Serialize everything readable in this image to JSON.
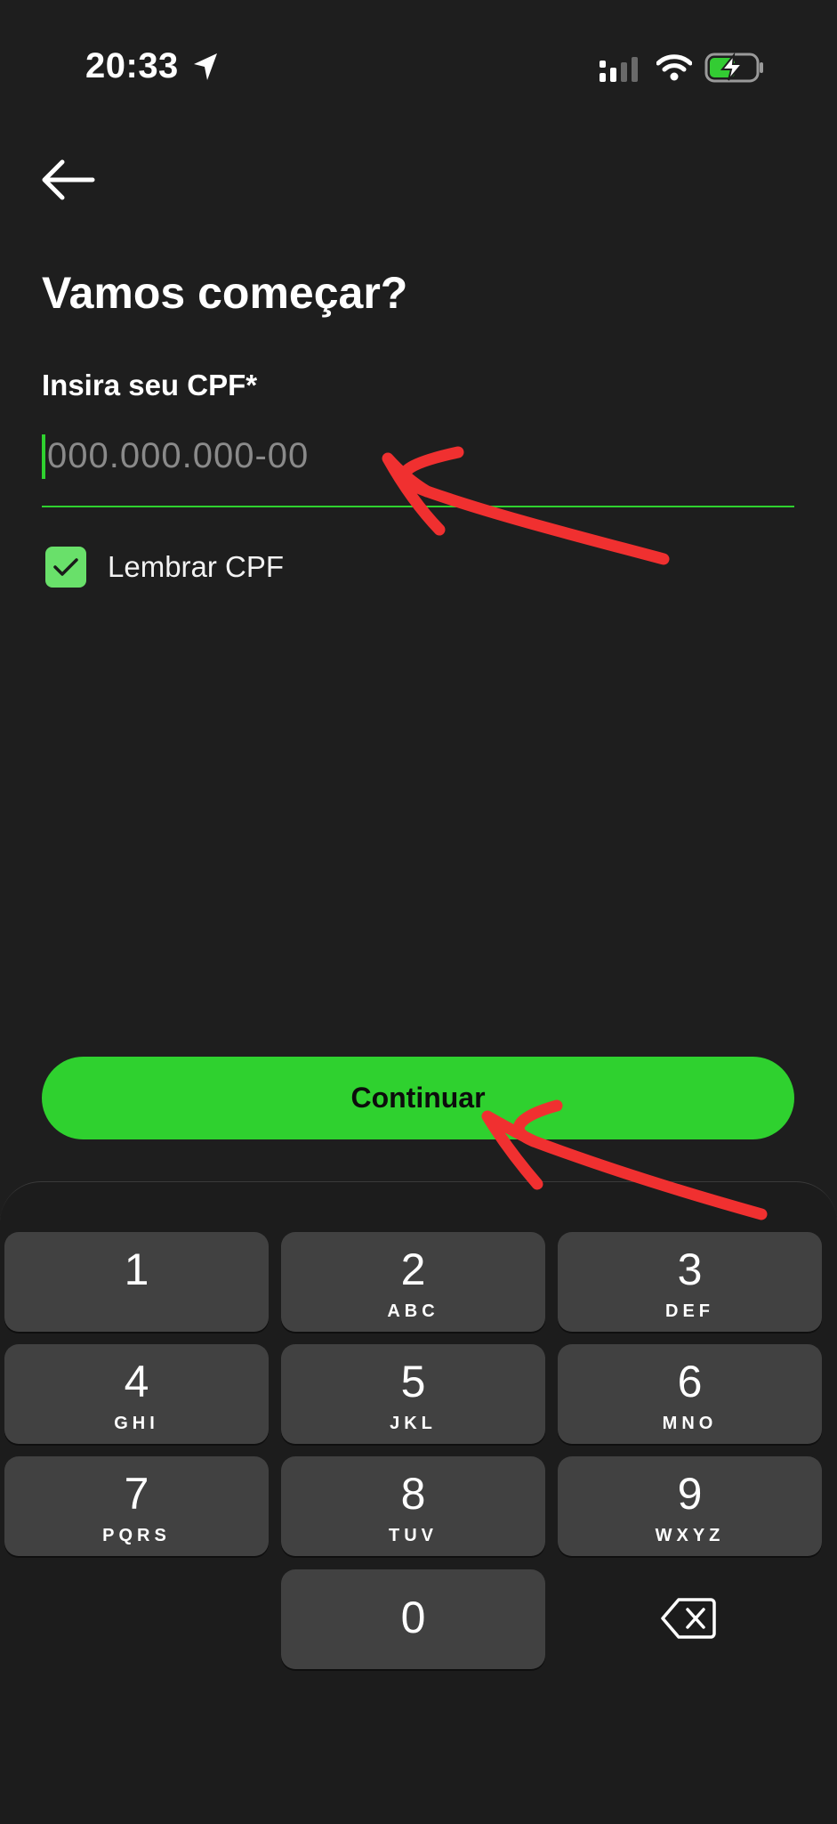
{
  "status_bar": {
    "time": "20:33"
  },
  "header": {
    "back_icon": "arrow-left-icon"
  },
  "main": {
    "title": "Vamos começar?",
    "cpf_label": "Insira seu CPF*",
    "cpf_placeholder": "000.000.000-00",
    "cpf_value": "",
    "remember_label": "Lembrar CPF",
    "remember_checked": true
  },
  "continue_label": "Continuar",
  "keypad": {
    "keys": [
      {
        "num": "1",
        "letters": ""
      },
      {
        "num": "2",
        "letters": "ABC"
      },
      {
        "num": "3",
        "letters": "DEF"
      },
      {
        "num": "4",
        "letters": "GHI"
      },
      {
        "num": "5",
        "letters": "JKL"
      },
      {
        "num": "6",
        "letters": "MNO"
      },
      {
        "num": "7",
        "letters": "PQRS"
      },
      {
        "num": "8",
        "letters": "TUV"
      },
      {
        "num": "9",
        "letters": "WXYZ"
      },
      {
        "num": "0",
        "letters": ""
      }
    ],
    "backspace_icon": "backspace-icon"
  },
  "colors": {
    "background": "#1e1e1e",
    "accent": "#2fd12f",
    "checkbox": "#69e06a",
    "key": "#414141",
    "annotation": "#f03030"
  }
}
